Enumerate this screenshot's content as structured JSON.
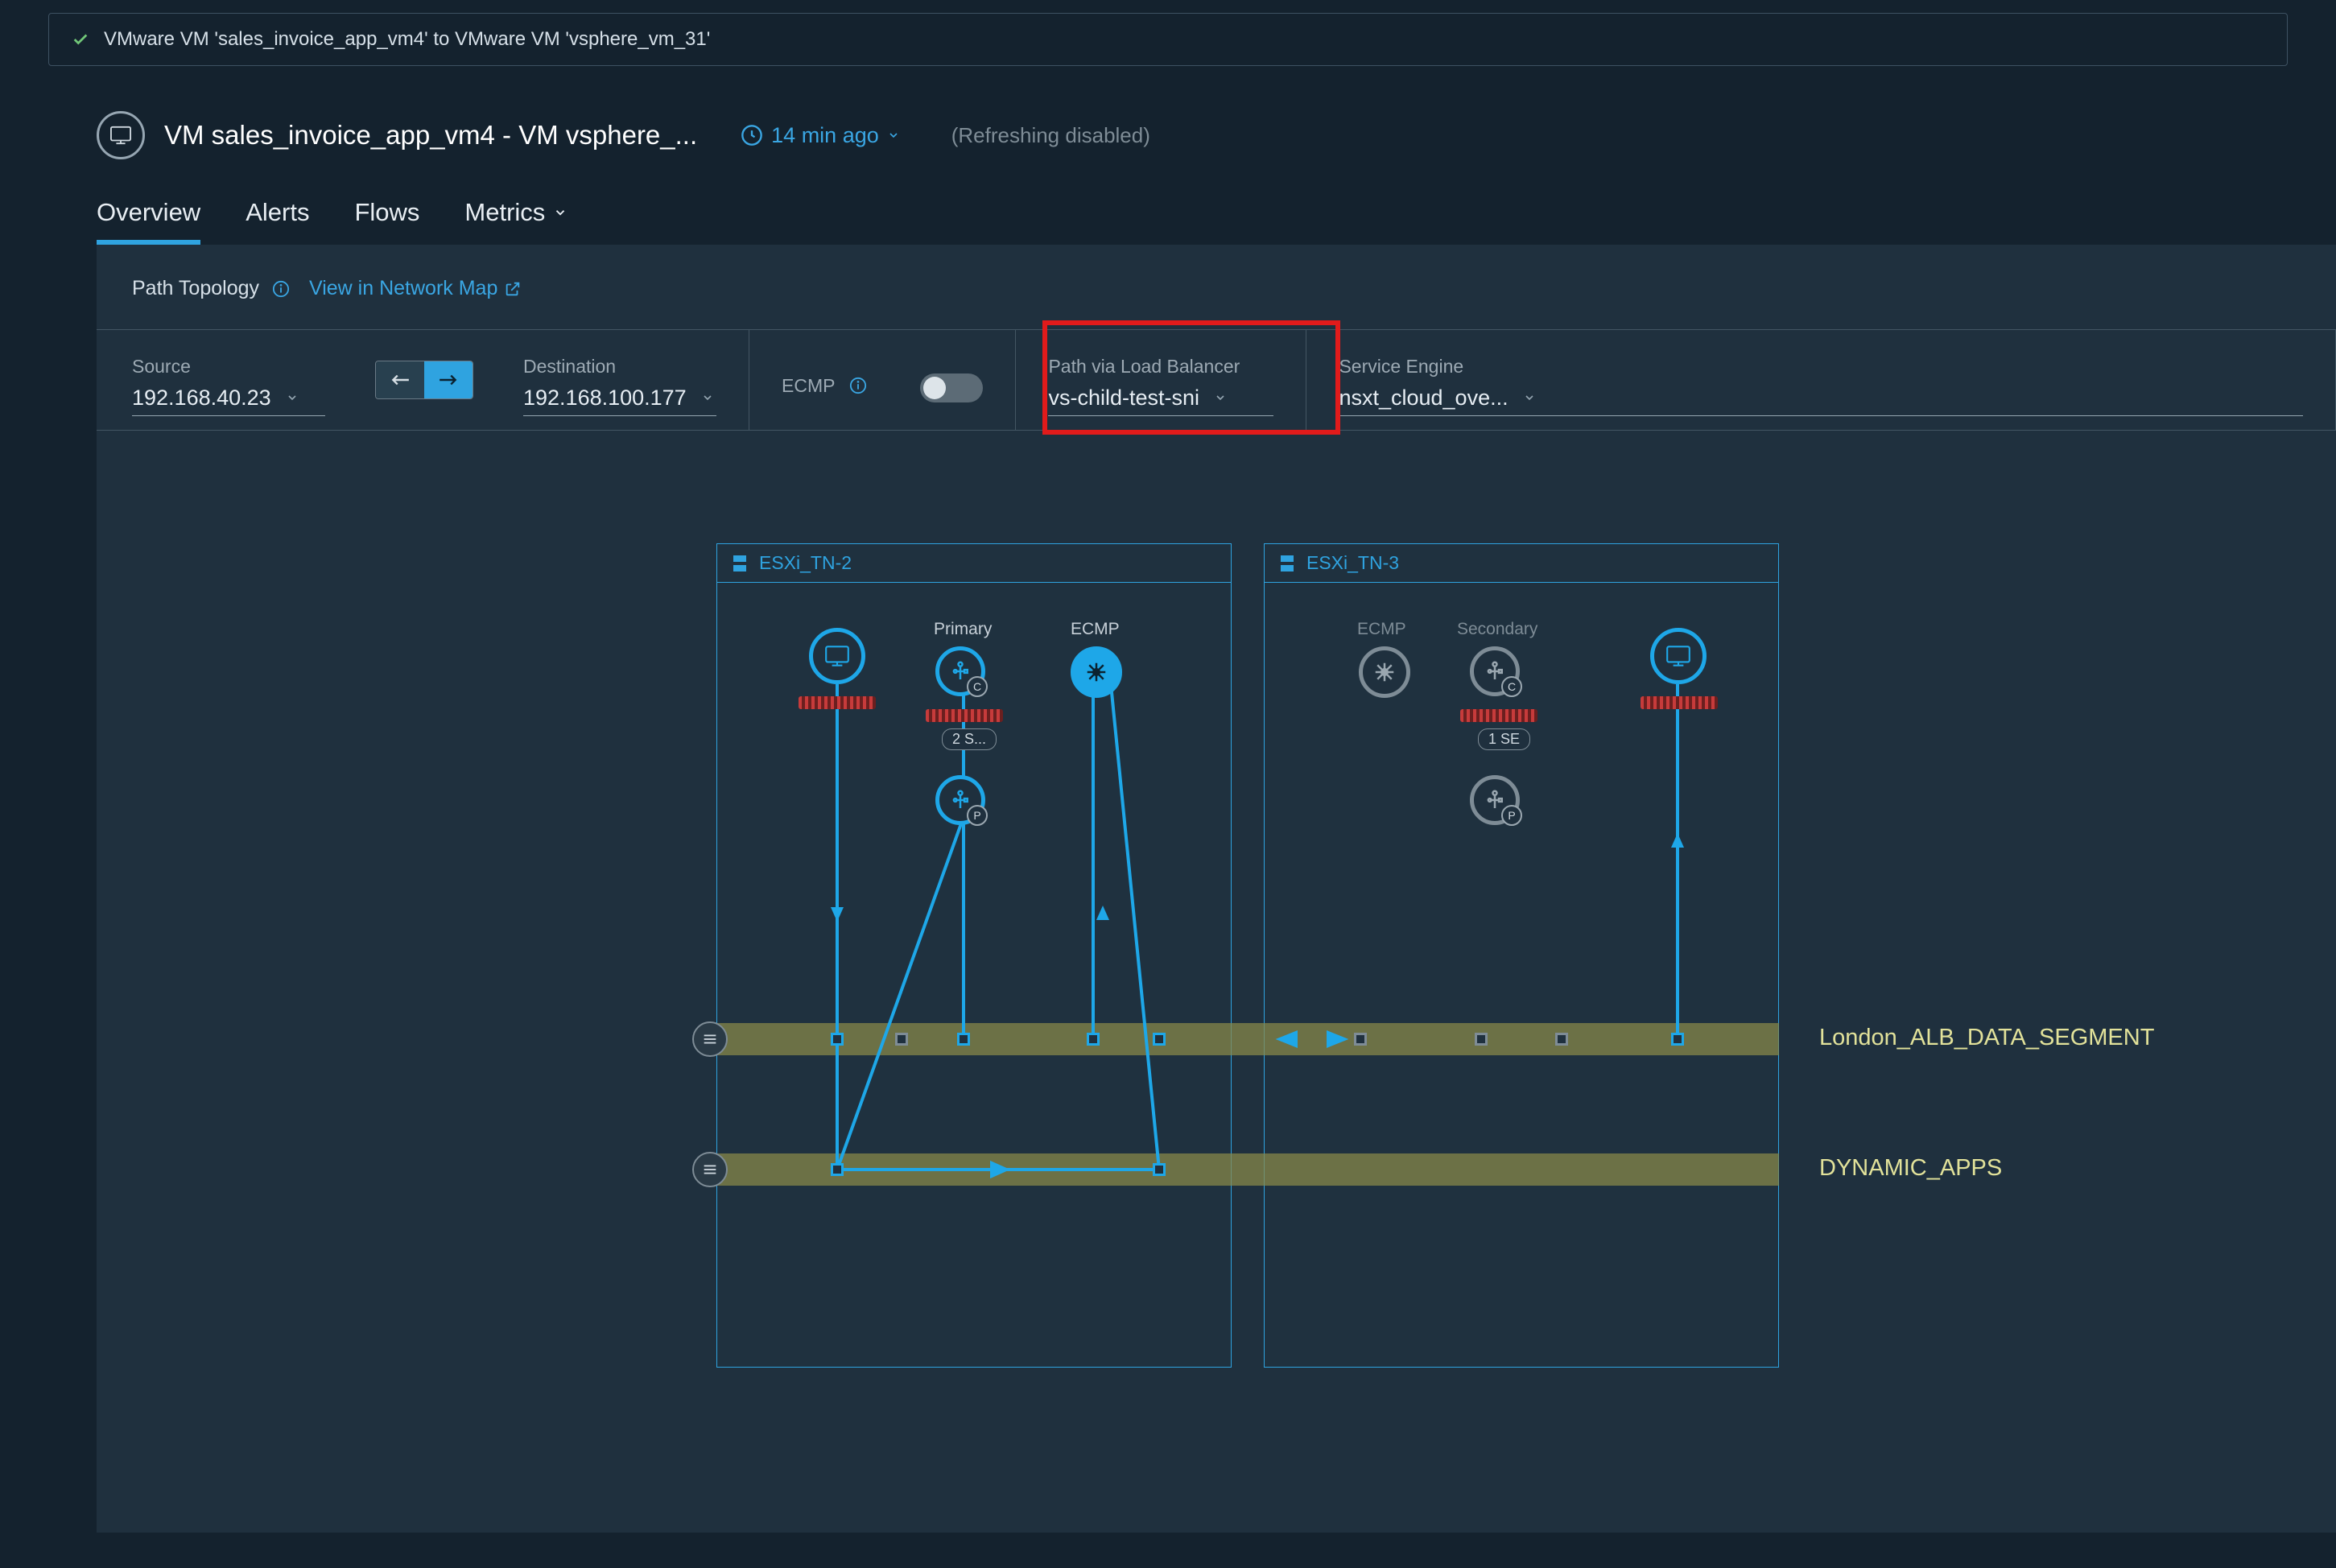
{
  "breadcrumb": "VMware VM 'sales_invoice_app_vm4' to VMware VM 'vsphere_vm_31'",
  "page_title": "VM sales_invoice_app_vm4 - VM vsphere_...",
  "time_ago": "14 min ago",
  "refreshing_text": "(Refreshing  disabled)",
  "tabs": {
    "overview": "Overview",
    "alerts": "Alerts",
    "flows": "Flows",
    "metrics": "Metrics"
  },
  "panel": {
    "title": "Path Topology",
    "link": "View in Network Map"
  },
  "controls": {
    "source_label": "Source",
    "source_value": "192.168.40.23",
    "dest_label": "Destination",
    "dest_value": "192.168.100.177",
    "ecmp_label": "ECMP",
    "pvlb_label": "Path via Load Balancer",
    "pvlb_value": "vs-child-test-sni",
    "se_label": "Service Engine",
    "se_value": "nsxt_cloud_ove..."
  },
  "topology": {
    "host_left": "ESXi_TN-2",
    "host_right": "ESXi_TN-3",
    "primary_label": "Primary",
    "secondary_label": "Secondary",
    "ecmp_label": "ECMP",
    "chip_left": "2 S...",
    "chip_right": "1 SE",
    "segment1": "London_ALB_DATA_SEGMENT",
    "segment2": "DYNAMIC_APPS"
  }
}
